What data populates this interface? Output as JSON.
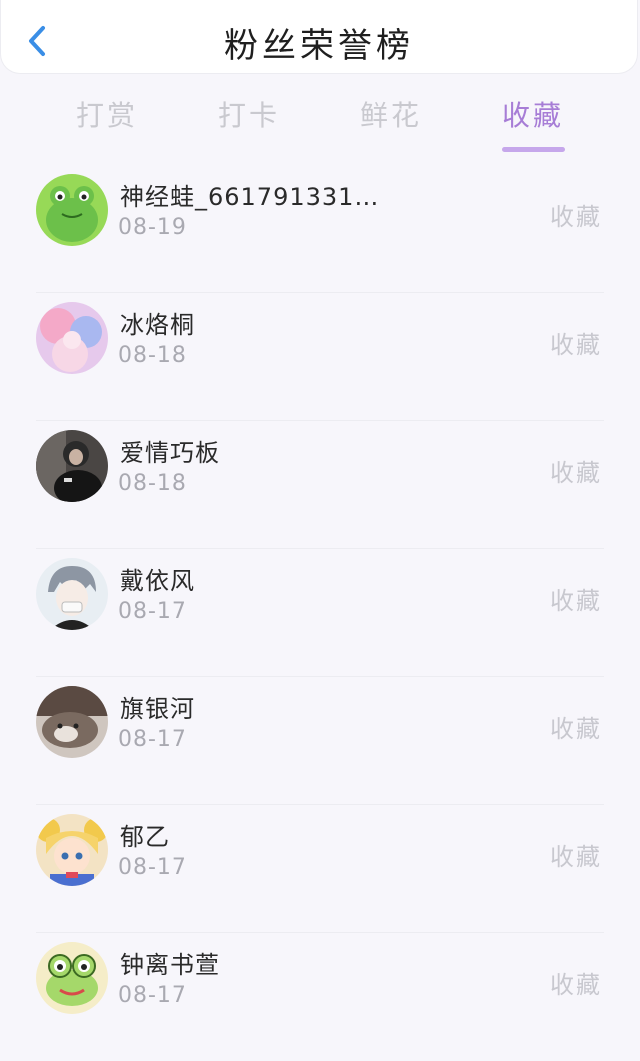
{
  "header": {
    "title": "粉丝荣誉榜"
  },
  "tabs": [
    {
      "label": "打赏",
      "active": false
    },
    {
      "label": "打卡",
      "active": false
    },
    {
      "label": "鲜花",
      "active": false
    },
    {
      "label": "收藏",
      "active": true
    }
  ],
  "colors": {
    "accent": "#a77dd6",
    "underline": "#c6a7eb"
  },
  "fans": [
    {
      "name": "神经蛙_661791331…",
      "date": "08-19",
      "tag": "收藏"
    },
    {
      "name": "冰烙桐",
      "date": "08-18",
      "tag": "收藏"
    },
    {
      "name": "爱情巧板",
      "date": "08-18",
      "tag": "收藏"
    },
    {
      "name": "戴依风",
      "date": "08-17",
      "tag": "收藏"
    },
    {
      "name": "旗银河",
      "date": "08-17",
      "tag": "收藏"
    },
    {
      "name": "郁乙",
      "date": "08-17",
      "tag": "收藏"
    },
    {
      "name": "钟离书萱",
      "date": "08-17",
      "tag": "收藏"
    }
  ]
}
